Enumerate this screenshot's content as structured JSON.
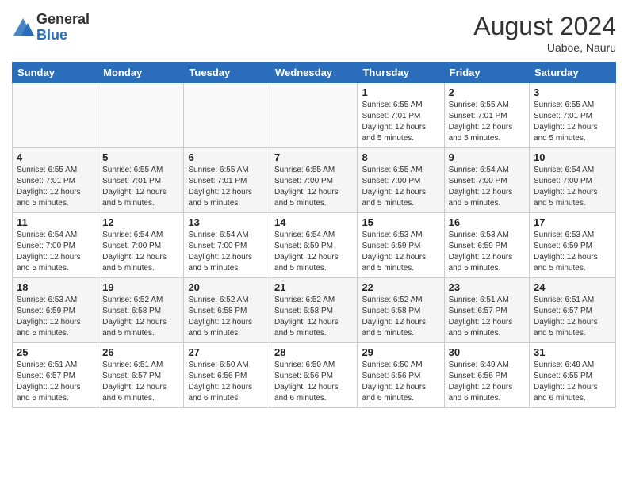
{
  "header": {
    "logo_general": "General",
    "logo_blue": "Blue",
    "title": "August 2024",
    "location": "Uaboe, Nauru"
  },
  "days_of_week": [
    "Sunday",
    "Monday",
    "Tuesday",
    "Wednesday",
    "Thursday",
    "Friday",
    "Saturday"
  ],
  "weeks": [
    [
      {
        "day": "",
        "info": ""
      },
      {
        "day": "",
        "info": ""
      },
      {
        "day": "",
        "info": ""
      },
      {
        "day": "",
        "info": ""
      },
      {
        "day": "1",
        "info": "Sunrise: 6:55 AM\nSunset: 7:01 PM\nDaylight: 12 hours and 5 minutes."
      },
      {
        "day": "2",
        "info": "Sunrise: 6:55 AM\nSunset: 7:01 PM\nDaylight: 12 hours and 5 minutes."
      },
      {
        "day": "3",
        "info": "Sunrise: 6:55 AM\nSunset: 7:01 PM\nDaylight: 12 hours and 5 minutes."
      }
    ],
    [
      {
        "day": "4",
        "info": "Sunrise: 6:55 AM\nSunset: 7:01 PM\nDaylight: 12 hours and 5 minutes."
      },
      {
        "day": "5",
        "info": "Sunrise: 6:55 AM\nSunset: 7:01 PM\nDaylight: 12 hours and 5 minutes."
      },
      {
        "day": "6",
        "info": "Sunrise: 6:55 AM\nSunset: 7:01 PM\nDaylight: 12 hours and 5 minutes."
      },
      {
        "day": "7",
        "info": "Sunrise: 6:55 AM\nSunset: 7:00 PM\nDaylight: 12 hours and 5 minutes."
      },
      {
        "day": "8",
        "info": "Sunrise: 6:55 AM\nSunset: 7:00 PM\nDaylight: 12 hours and 5 minutes."
      },
      {
        "day": "9",
        "info": "Sunrise: 6:54 AM\nSunset: 7:00 PM\nDaylight: 12 hours and 5 minutes."
      },
      {
        "day": "10",
        "info": "Sunrise: 6:54 AM\nSunset: 7:00 PM\nDaylight: 12 hours and 5 minutes."
      }
    ],
    [
      {
        "day": "11",
        "info": "Sunrise: 6:54 AM\nSunset: 7:00 PM\nDaylight: 12 hours and 5 minutes."
      },
      {
        "day": "12",
        "info": "Sunrise: 6:54 AM\nSunset: 7:00 PM\nDaylight: 12 hours and 5 minutes."
      },
      {
        "day": "13",
        "info": "Sunrise: 6:54 AM\nSunset: 7:00 PM\nDaylight: 12 hours and 5 minutes."
      },
      {
        "day": "14",
        "info": "Sunrise: 6:54 AM\nSunset: 6:59 PM\nDaylight: 12 hours and 5 minutes."
      },
      {
        "day": "15",
        "info": "Sunrise: 6:53 AM\nSunset: 6:59 PM\nDaylight: 12 hours and 5 minutes."
      },
      {
        "day": "16",
        "info": "Sunrise: 6:53 AM\nSunset: 6:59 PM\nDaylight: 12 hours and 5 minutes."
      },
      {
        "day": "17",
        "info": "Sunrise: 6:53 AM\nSunset: 6:59 PM\nDaylight: 12 hours and 5 minutes."
      }
    ],
    [
      {
        "day": "18",
        "info": "Sunrise: 6:53 AM\nSunset: 6:59 PM\nDaylight: 12 hours and 5 minutes."
      },
      {
        "day": "19",
        "info": "Sunrise: 6:52 AM\nSunset: 6:58 PM\nDaylight: 12 hours and 5 minutes."
      },
      {
        "day": "20",
        "info": "Sunrise: 6:52 AM\nSunset: 6:58 PM\nDaylight: 12 hours and 5 minutes."
      },
      {
        "day": "21",
        "info": "Sunrise: 6:52 AM\nSunset: 6:58 PM\nDaylight: 12 hours and 5 minutes."
      },
      {
        "day": "22",
        "info": "Sunrise: 6:52 AM\nSunset: 6:58 PM\nDaylight: 12 hours and 5 minutes."
      },
      {
        "day": "23",
        "info": "Sunrise: 6:51 AM\nSunset: 6:57 PM\nDaylight: 12 hours and 5 minutes."
      },
      {
        "day": "24",
        "info": "Sunrise: 6:51 AM\nSunset: 6:57 PM\nDaylight: 12 hours and 5 minutes."
      }
    ],
    [
      {
        "day": "25",
        "info": "Sunrise: 6:51 AM\nSunset: 6:57 PM\nDaylight: 12 hours and 5 minutes."
      },
      {
        "day": "26",
        "info": "Sunrise: 6:51 AM\nSunset: 6:57 PM\nDaylight: 12 hours and 6 minutes."
      },
      {
        "day": "27",
        "info": "Sunrise: 6:50 AM\nSunset: 6:56 PM\nDaylight: 12 hours and 6 minutes."
      },
      {
        "day": "28",
        "info": "Sunrise: 6:50 AM\nSunset: 6:56 PM\nDaylight: 12 hours and 6 minutes."
      },
      {
        "day": "29",
        "info": "Sunrise: 6:50 AM\nSunset: 6:56 PM\nDaylight: 12 hours and 6 minutes."
      },
      {
        "day": "30",
        "info": "Sunrise: 6:49 AM\nSunset: 6:56 PM\nDaylight: 12 hours and 6 minutes."
      },
      {
        "day": "31",
        "info": "Sunrise: 6:49 AM\nSunset: 6:55 PM\nDaylight: 12 hours and 6 minutes."
      }
    ]
  ]
}
